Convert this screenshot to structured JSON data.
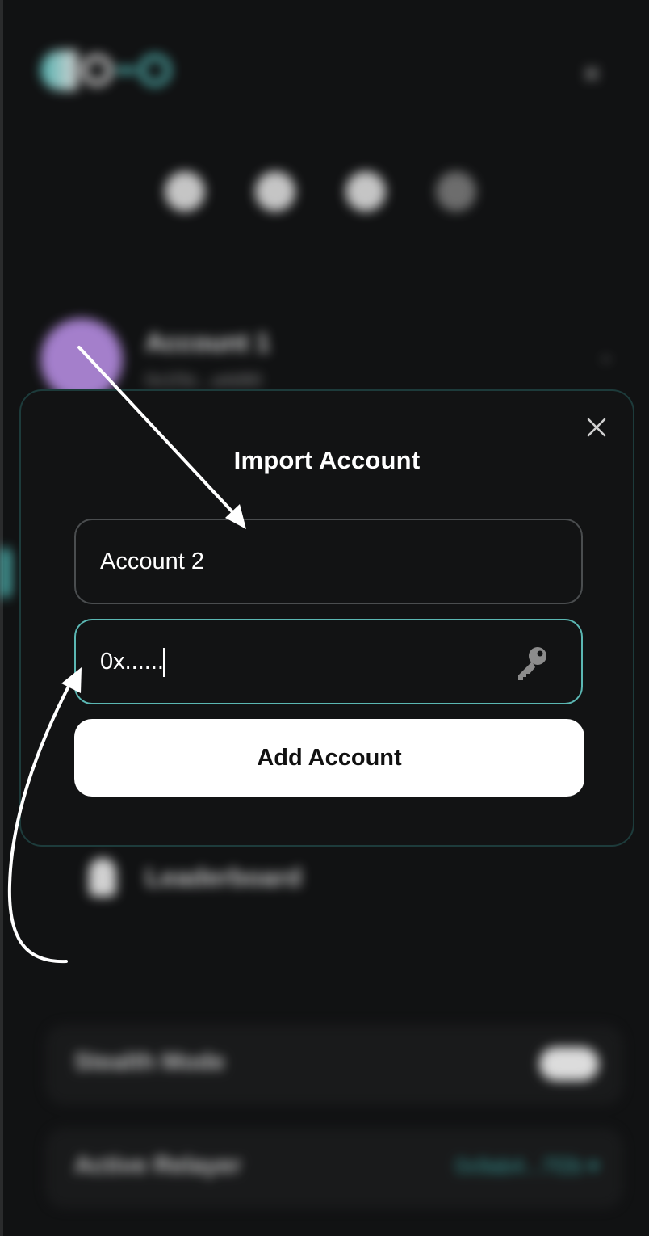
{
  "background": {
    "close_glyph": "×",
    "account": {
      "name": "Account 1",
      "address": "0x1f3c...a4d90",
      "chevron": "⌄"
    },
    "menu": {
      "leaderboard_label": "Leaderboard"
    },
    "settings": {
      "stealth_mode_label": "Stealth Mode",
      "active_relayer_label": "Active Relayer",
      "active_relayer_value": "0x9ab4...7f2b ▾"
    }
  },
  "modal": {
    "title": "Import Account",
    "name_field": {
      "value": "Account 2"
    },
    "key_field": {
      "value": "0x......"
    },
    "submit_label": "Add Account"
  },
  "colors": {
    "accent": "#5bb7b3",
    "background": "#111213",
    "button": "#ffffff"
  }
}
